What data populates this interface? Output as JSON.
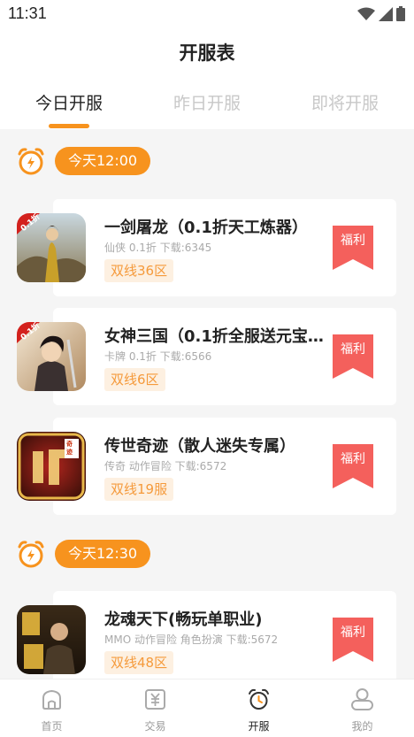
{
  "status_bar": {
    "time": "11:31"
  },
  "page_title": "开服表",
  "tabs": [
    {
      "label": "今日开服",
      "active": true
    },
    {
      "label": "昨日开服",
      "active": false
    },
    {
      "label": "即将开服",
      "active": false
    }
  ],
  "groups": [
    {
      "time": "今天12:00",
      "games": [
        {
          "title": "一剑屠龙（0.1折天工炼器）",
          "meta": "仙侠 0.1折 下载:6345",
          "server": "双线36区",
          "welfare": "福利",
          "icon": "game-icon-yijian",
          "icon_badge": "0.1折"
        },
        {
          "title": "女神三国（0.1折全服送元宝…",
          "meta": "卡牌 0.1折 下载:6566",
          "server": "双线6区",
          "welfare": "福利",
          "icon": "game-icon-nvshen",
          "icon_badge": "0.1折"
        },
        {
          "title": "传世奇迹（散人迷失专属）",
          "meta": "传奇 动作冒险 下载:6572",
          "server": "双线19服",
          "welfare": "福利",
          "icon": "game-icon-chuanshi",
          "icon_badge": "奇迹"
        }
      ]
    },
    {
      "time": "今天12:30",
      "games": [
        {
          "title": "龙魂天下(畅玩单职业)",
          "meta": "MMO 动作冒险 角色扮演 下载:5672",
          "server": "双线48区",
          "welfare": "福利",
          "icon": "game-icon-longhun",
          "icon_badge": ""
        }
      ]
    }
  ],
  "bottom_nav": [
    {
      "label": "首页",
      "icon": "home-icon",
      "active": false
    },
    {
      "label": "交易",
      "icon": "trade-icon",
      "active": false
    },
    {
      "label": "开服",
      "icon": "alarm-clock-icon",
      "active": true
    },
    {
      "label": "我的",
      "icon": "profile-icon",
      "active": false
    }
  ],
  "colors": {
    "accent": "#f7931e",
    "welfare": "#f4605c",
    "tag_bg": "#fdf0e1",
    "tag_text": "#f59a3b"
  }
}
